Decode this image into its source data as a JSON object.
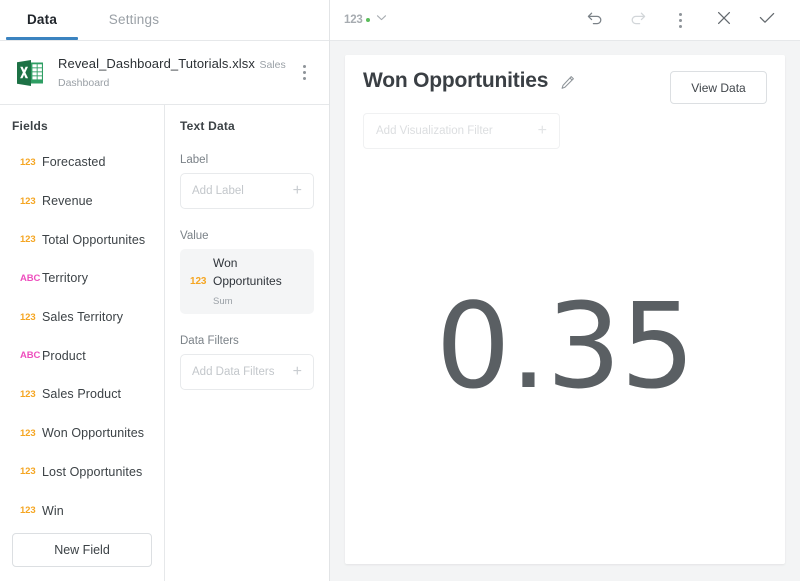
{
  "tabs": [
    {
      "label": "Data",
      "active": true
    },
    {
      "label": "Settings",
      "active": false
    }
  ],
  "file": {
    "name": "Reveal_Dashboard_Tutorials.xlsx",
    "subtitle": "Sales Dashboard",
    "icon": "excel-file-icon",
    "menu_icon": "kebab-menu-icon"
  },
  "fields_panel": {
    "title": "Fields",
    "items": [
      {
        "type": "123",
        "label": "Forecasted"
      },
      {
        "type": "123",
        "label": "Revenue"
      },
      {
        "type": "123",
        "label": "Total Opportunites"
      },
      {
        "type": "ABC",
        "label": "Territory"
      },
      {
        "type": "123",
        "label": "Sales Territory"
      },
      {
        "type": "ABC",
        "label": "Product"
      },
      {
        "type": "123",
        "label": "Sales Product"
      },
      {
        "type": "123",
        "label": "Won Opportunites"
      },
      {
        "type": "123",
        "label": "Lost Opportunites"
      },
      {
        "type": "123",
        "label": "Win"
      }
    ],
    "new_field_label": "New Field"
  },
  "text_data_panel": {
    "title": "Text Data",
    "label_section": {
      "heading": "Label",
      "placeholder": "Add Label",
      "add_icon": "plus-icon"
    },
    "value_section": {
      "heading": "Value",
      "chip": {
        "type": "123",
        "name": "Won Opportunites",
        "aggregation": "Sum"
      }
    },
    "data_filters_section": {
      "heading": "Data Filters",
      "placeholder": "Add Data Filters",
      "add_icon": "plus-icon"
    }
  },
  "toolbar": {
    "viz_type_label": "123",
    "viz_type_chevron": "chevron-down-icon",
    "status_dot_color": "#5bbd5b",
    "undo_icon": "undo-icon",
    "redo_icon": "redo-icon",
    "more_icon": "kebab-menu-icon",
    "close_icon": "close-icon",
    "confirm_icon": "checkmark-icon"
  },
  "visualization": {
    "title": "Won Opportunities",
    "edit_icon": "pencil-icon",
    "view_data_label": "View Data",
    "filter_placeholder": "Add Visualization Filter",
    "filter_add_icon": "plus-icon",
    "kpi_value": "0.35"
  },
  "colors": {
    "accent_blue": "#3b83c0",
    "numeric_field": "#f5a623",
    "text_field": "#ee4fbe",
    "excel_green": "#1d7145",
    "canvas_bg": "#f3f4f5"
  }
}
